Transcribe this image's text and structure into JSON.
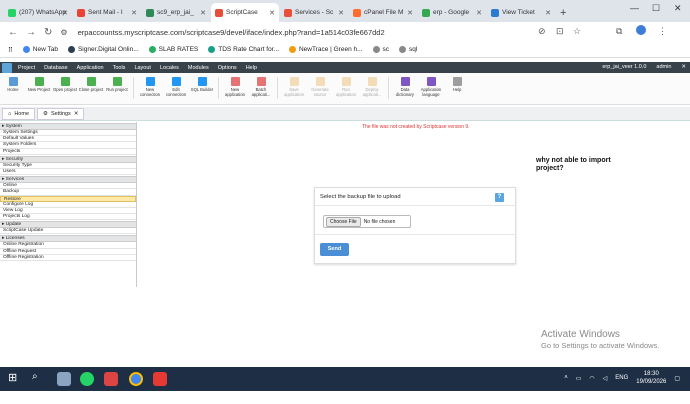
{
  "browser": {
    "tabs": [
      {
        "label": "(207) WhatsApp",
        "color": "#25d366"
      },
      {
        "label": "Sent Mail - I",
        "color": "#ea4335"
      },
      {
        "label": "sc9_erp_jai_",
        "color": "#2e8b57"
      },
      {
        "label": "ScriptCase",
        "color": "#e84f39",
        "active": true
      },
      {
        "label": "Services - Sc",
        "color": "#e84f39"
      },
      {
        "label": "cPanel File M",
        "color": "#ff6c2c"
      },
      {
        "label": "erp - Google",
        "color": "#34a853"
      },
      {
        "label": "View Ticket",
        "color": "#2b7bd1"
      }
    ],
    "url": "erpaccountss.myscriptcase.com/scriptcase9/devel/iface/index.php?rand=1a514c03fe667dd2",
    "bookmarks": [
      {
        "label": "New Tab",
        "color": "#4285f4"
      },
      {
        "label": "Signer.Digital Onlin...",
        "color": "#2c3e50"
      },
      {
        "label": "SLAB RATES",
        "color": "#27ae60"
      },
      {
        "label": "TDS Rate Chart for...",
        "color": "#16a085"
      },
      {
        "label": "NewTrace | Green h...",
        "color": "#f39c12"
      },
      {
        "label": "sc",
        "color": "#888888"
      },
      {
        "label": "sql",
        "color": "#888888"
      }
    ]
  },
  "scmenu": {
    "items": [
      "Project",
      "Database",
      "Application",
      "Tools",
      "Layout",
      "Locales",
      "Modules",
      "Options",
      "Help"
    ],
    "project_name": "erp_jai_veer 1.0.0",
    "user": "admin"
  },
  "toolbar": [
    {
      "label": "Home",
      "color": "#5b9bd5",
      "disabled": false
    },
    {
      "label": "New Project",
      "color": "#4caf50",
      "disabled": false
    },
    {
      "label": "Open project",
      "color": "#4caf50",
      "disabled": false
    },
    {
      "label": "Close project",
      "color": "#4caf50",
      "disabled": false
    },
    {
      "label": "Run project",
      "color": "#4caf50",
      "disabled": false
    },
    {
      "sep": true
    },
    {
      "label": "New connection",
      "color": "#2196f3",
      "disabled": false
    },
    {
      "label": "Edit connection",
      "color": "#2196f3",
      "disabled": false
    },
    {
      "label": "SQL Builder",
      "color": "#2196f3",
      "disabled": false
    },
    {
      "sep": true
    },
    {
      "label": "New application",
      "color": "#e57373",
      "disabled": false
    },
    {
      "label": "Batch applicati...",
      "color": "#e57373",
      "disabled": false
    },
    {
      "sep": true
    },
    {
      "label": "Save application",
      "color": "#e6a23c",
      "disabled": true
    },
    {
      "label": "Generate source",
      "color": "#e6a23c",
      "disabled": true
    },
    {
      "label": "Run application",
      "color": "#e6a23c",
      "disabled": true
    },
    {
      "label": "Deploy applicati...",
      "color": "#e6a23c",
      "disabled": true
    },
    {
      "sep": true
    },
    {
      "label": "Data dictionary",
      "color": "#7e57c2",
      "disabled": false
    },
    {
      "label": "Application language",
      "color": "#7e57c2",
      "disabled": false
    },
    {
      "label": "Help",
      "color": "#9e9e9e",
      "disabled": false
    }
  ],
  "apptabs": {
    "home": "Home",
    "settings": "Settings"
  },
  "sidebar": [
    {
      "header": "System"
    },
    {
      "item": "System Settings"
    },
    {
      "item": "Default Values"
    },
    {
      "item": "System Folders"
    },
    {
      "item": "Projects"
    },
    {
      "header": "Security"
    },
    {
      "item": "Security Type"
    },
    {
      "item": "Users"
    },
    {
      "header": "Services"
    },
    {
      "item": "Online"
    },
    {
      "item": "Backup"
    },
    {
      "item": "Restore",
      "selected": true
    },
    {
      "item": "Configure Log"
    },
    {
      "item": "View Log"
    },
    {
      "item": "Projects Log"
    },
    {
      "header": "Update"
    },
    {
      "item": "ScriptCase Update"
    },
    {
      "header": "Licenses"
    },
    {
      "item": "Online Registration"
    },
    {
      "item": "Offline Request"
    },
    {
      "item": "Offline Registration"
    }
  ],
  "main": {
    "warning": "The file was not created by Scriptcase version 9.",
    "question": "why not able to import project?",
    "panel": {
      "title": "Select the backup file to upload",
      "help": "?",
      "choose_button": "Choose File",
      "file_status": "No file chosen",
      "send_button": "Send"
    }
  },
  "watermark": {
    "line1": "Activate Windows",
    "line2": "Go to Settings to activate Windows."
  },
  "taskbar": {
    "lang": "ENG",
    "time": "18:30",
    "date": "19/09/2026"
  }
}
